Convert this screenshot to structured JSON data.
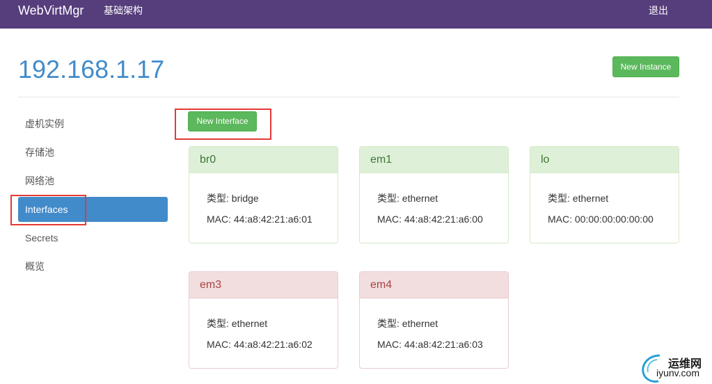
{
  "navbar": {
    "brand": "WebVirtMgr",
    "infra_label": "基础架构",
    "logout_label": "退出"
  },
  "page": {
    "title": "192.168.1.17",
    "new_instance_label": "New Instance",
    "new_interface_label": "New Interface"
  },
  "sidebar": {
    "items": [
      {
        "label": "虚机实例"
      },
      {
        "label": "存储池"
      },
      {
        "label": "网络池"
      },
      {
        "label": "Interfaces",
        "active": true
      },
      {
        "label": "Secrets"
      },
      {
        "label": "概览"
      }
    ]
  },
  "interfaces": [
    {
      "name": "br0",
      "type": "类型: bridge",
      "mac": "MAC: 44:a8:42:21:a6:01",
      "state": "success"
    },
    {
      "name": "em1",
      "type": "类型: ethernet",
      "mac": "MAC: 44:a8:42:21:a6:00",
      "state": "success"
    },
    {
      "name": "lo",
      "type": "类型: ethernet",
      "mac": "MAC: 00:00:00:00:00:00",
      "state": "success"
    },
    {
      "name": "em3",
      "type": "类型: ethernet",
      "mac": "MAC: 44:a8:42:21:a6:02",
      "state": "danger"
    },
    {
      "name": "em4",
      "type": "类型: ethernet",
      "mac": "MAC: 44:a8:42:21:a6:03",
      "state": "danger"
    }
  ],
  "watermark": {
    "cn": "运维网",
    "en": "iyunv.com"
  },
  "colors": {
    "navbar": "#563d7c",
    "accent": "#428bca",
    "success": "#5cb85c",
    "highlight": "#e53935"
  }
}
